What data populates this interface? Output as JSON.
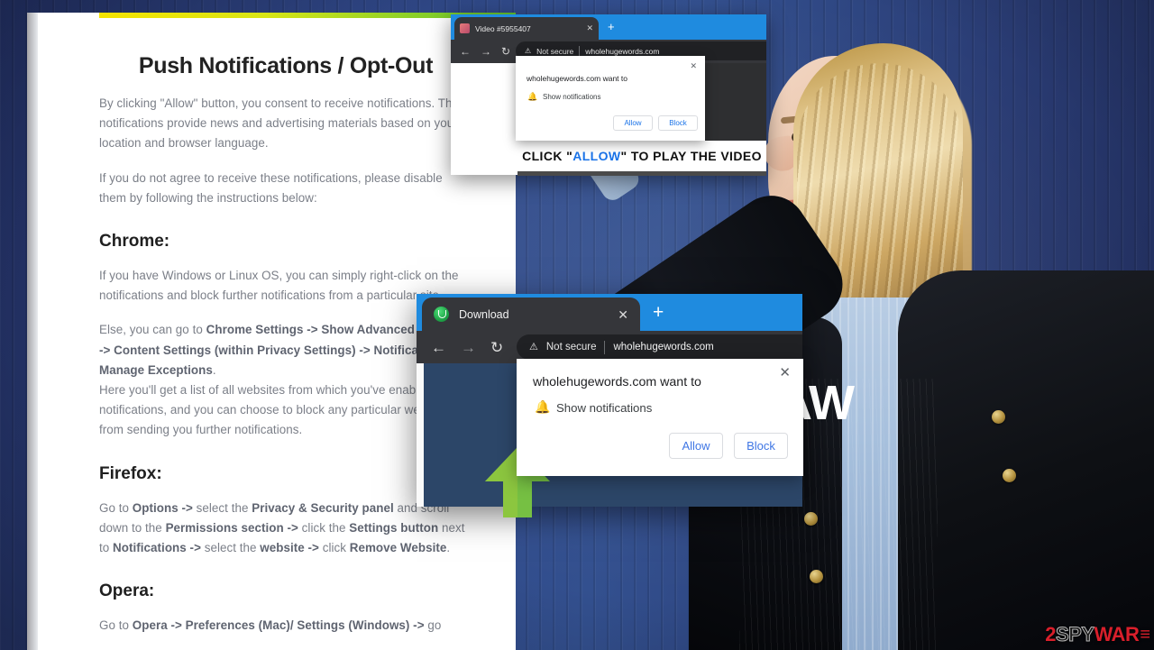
{
  "document": {
    "heading": "Push Notifications / Opt-Out",
    "intro": "By clicking \"Allow\" button, you consent to receive notifications. The notifications provide news and advertising materials based on your location and browser language.",
    "intro2": "If you do not agree to receive these notifications, please disable them by following the instructions below:",
    "chrome": {
      "heading": "Chrome:",
      "para1": "If you have Windows or Linux OS, you can simply right-click on the notifications and block further notifications from a particular site.",
      "para2_prefix": "Else, you can go to ",
      "para2_bold": "Chrome Settings -> Show Advanced Settings -> Content Settings (within Privacy Settings) -> Notifications -> Manage Exceptions",
      "para2_suffix": ".",
      "para3": "Here you'll get a list of all websites from which you've enabled notifications, and you can choose to block any particular website from sending you further notifications."
    },
    "firefox": {
      "heading": "Firefox:",
      "s1": "Go to ",
      "b1": "Options ->",
      "s2": " select the ",
      "b2": "Privacy & Security panel",
      "s3": " and scroll down to the ",
      "b3": "Permissions section ->",
      "s4": " click the ",
      "b4": "Settings button",
      "s5": " next to ",
      "b5": "Notifications ->",
      "s6": " select the ",
      "b6": "website ->",
      "s7": " click ",
      "b7": "Remove Website",
      "s8": "."
    },
    "opera": {
      "heading": "Opera:",
      "s1": "Go to ",
      "b1": "Opera -> Preferences (Mac)/ Settings (Windows) ->",
      "s2": " go"
    }
  },
  "small_window": {
    "tab_title": "Video #5955407",
    "tab_close": "✕",
    "new_tab": "+",
    "back": "←",
    "forward": "→",
    "reload": "↻",
    "warning_icon": "⚠",
    "not_secure": "Not secure",
    "url": "wholehugewords.com",
    "popup": {
      "close": "✕",
      "title": "wholehugewords.com want to",
      "bell": "🔔",
      "permission": "Show notifications",
      "allow": "Allow",
      "block": "Block"
    },
    "banner_pre": "CLICK \"",
    "banner_hl": "ALLOW",
    "banner_post": "\" TO PLAY THE VIDEO"
  },
  "large_window": {
    "tab_title": "Download",
    "tab_close": "✕",
    "new_tab": "+",
    "back": "←",
    "forward": "→",
    "reload": "↻",
    "warning_icon": "⚠",
    "not_secure": "Not secure",
    "url": "wholehugewords.com",
    "page_letters": "AW",
    "popup": {
      "close": "✕",
      "title": "wholehugewords.com want to",
      "bell": "🔔",
      "permission": "Show notifications",
      "allow": "Allow",
      "block": "Block"
    }
  },
  "watermark": {
    "num": "2",
    "spy": "SPY",
    "war": "WAR",
    "tail": "≡"
  },
  "colors": {
    "accent_blue": "#1f8bdf",
    "link_blue": "#3f76e4",
    "arrow_green": "#76c043",
    "wall_blue": "#2f4686",
    "watermark_red": "#d91f2b"
  }
}
